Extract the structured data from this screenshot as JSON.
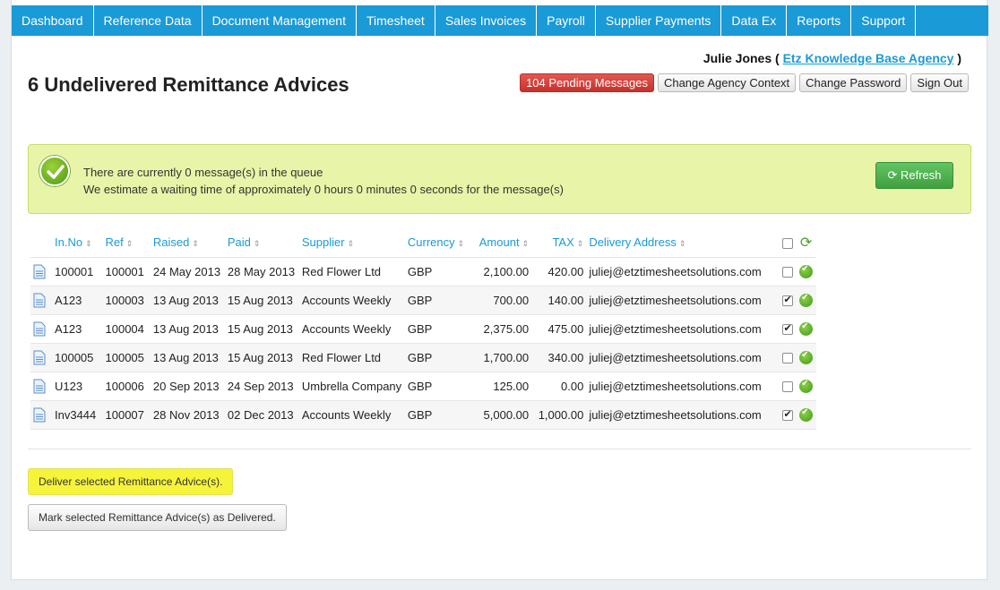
{
  "nav": {
    "items": [
      "Dashboard",
      "Reference Data",
      "Document Management",
      "Timesheet",
      "Sales Invoices",
      "Payroll",
      "Supplier Payments",
      "Data Ex",
      "Reports",
      "Support"
    ]
  },
  "header": {
    "user_name": "Julie Jones",
    "agency_link": "Etz Knowledge Base Agency",
    "title": "6 Undelivered Remittance Advices",
    "pending_button": "104 Pending Messages",
    "change_agency_button": "Change Agency Context",
    "change_password_button": "Change Password",
    "sign_out_button": "Sign Out"
  },
  "alert": {
    "line1": "There are currently 0 message(s) in the queue",
    "line2": "We estimate a waiting time of approximately 0 hours 0 minutes 0 seconds for the message(s)",
    "refresh_button": "Refresh",
    "accent": "#e8f5a8"
  },
  "table": {
    "headers": [
      "In.No",
      "Ref",
      "Raised",
      "Paid",
      "Supplier",
      "Currency",
      "Amount",
      "TAX",
      "Delivery Address"
    ],
    "rows": [
      {
        "in_no": "100001",
        "ref": "100001",
        "raised": "24 May 2013",
        "paid": "28 May 2013",
        "supplier": "Red Flower Ltd",
        "currency": "GBP",
        "amount": "2,100.00",
        "tax": "420.00",
        "address": "juliej@etztimesheetsolutions.com",
        "selected": false
      },
      {
        "in_no": "A123",
        "ref": "100003",
        "raised": "13 Aug 2013",
        "paid": "15 Aug 2013",
        "supplier": "Accounts Weekly",
        "currency": "GBP",
        "amount": "700.00",
        "tax": "140.00",
        "address": "juliej@etztimesheetsolutions.com",
        "selected": true
      },
      {
        "in_no": "A123",
        "ref": "100004",
        "raised": "13 Aug 2013",
        "paid": "15 Aug 2013",
        "supplier": "Accounts Weekly",
        "currency": "GBP",
        "amount": "2,375.00",
        "tax": "475.00",
        "address": "juliej@etztimesheetsolutions.com",
        "selected": true
      },
      {
        "in_no": "100005",
        "ref": "100005",
        "raised": "13 Aug 2013",
        "paid": "15 Aug 2013",
        "supplier": "Red Flower Ltd",
        "currency": "GBP",
        "amount": "1,700.00",
        "tax": "340.00",
        "address": "juliej@etztimesheetsolutions.com",
        "selected": false
      },
      {
        "in_no": "U123",
        "ref": "100006",
        "raised": "20 Sep 2013",
        "paid": "24 Sep 2013",
        "supplier": "Umbrella Company",
        "currency": "GBP",
        "amount": "125.00",
        "tax": "0.00",
        "address": "juliej@etztimesheetsolutions.com",
        "selected": false
      },
      {
        "in_no": "Inv3444",
        "ref": "100007",
        "raised": "28 Nov 2013",
        "paid": "02 Dec 2013",
        "supplier": "Accounts Weekly",
        "currency": "GBP",
        "amount": "5,000.00",
        "tax": "1,000.00",
        "address": "juliej@etztimesheetsolutions.com",
        "selected": true
      }
    ]
  },
  "actions": {
    "deliver_button": "Deliver selected Remittance Advice(s).",
    "mark_delivered_button": "Mark selected Remittance Advice(s) as Delivered."
  },
  "colors": {
    "nav": "#1a9ad6",
    "highlight": "#f6f43a",
    "danger": "#c8302b",
    "success": "#3f9f3f"
  }
}
